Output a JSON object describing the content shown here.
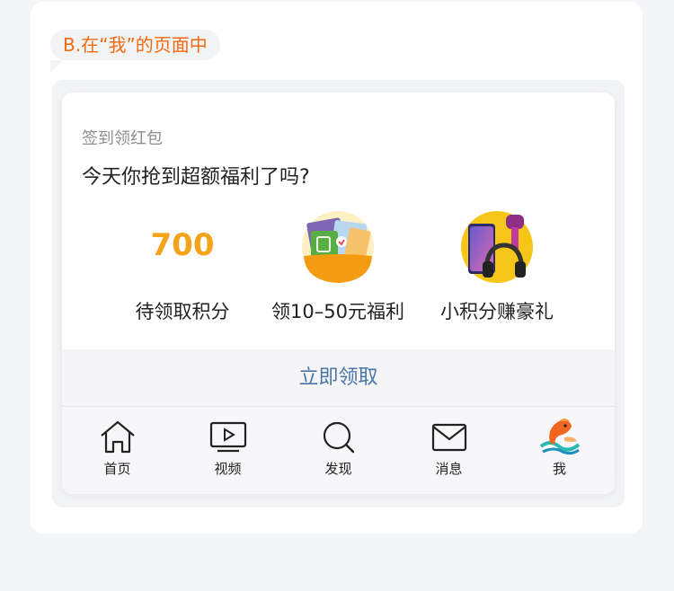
{
  "section_tag": "B.在“我”的页面中",
  "card": {
    "subtitle": "签到领红包",
    "headline": "今天你抢到超额福利了吗?",
    "features": [
      {
        "value": "700",
        "label": "待领取积分"
      },
      {
        "label": "领10–50元福利",
        "icon": "coupon-illustration"
      },
      {
        "label": "小积分赚豪礼",
        "icon": "gift-products-illustration"
      }
    ],
    "claim_button": "立即领取"
  },
  "tabbar": {
    "tabs": [
      {
        "label": "首页",
        "icon": "home-icon"
      },
      {
        "label": "视频",
        "icon": "video-icon"
      },
      {
        "label": "发现",
        "icon": "search-icon"
      },
      {
        "label": "消息",
        "icon": "mail-icon"
      },
      {
        "label": "我",
        "icon": "koi-avatar-icon"
      }
    ]
  },
  "colors": {
    "accent_orange": "#f36a10",
    "points_gold": "#f5a31a",
    "link_blue": "#4a76a8"
  }
}
